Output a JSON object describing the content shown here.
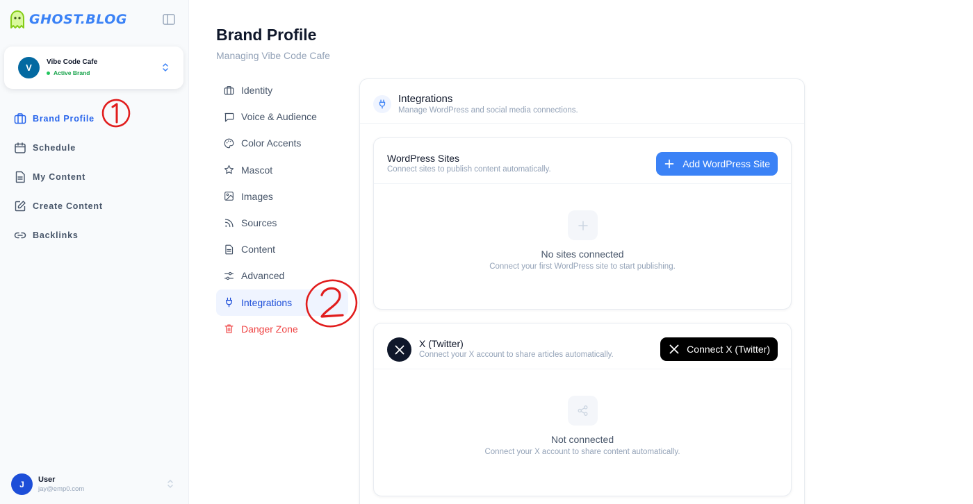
{
  "app": {
    "logo_text": "GHOST.BLOG"
  },
  "brand": {
    "avatar_initial": "V",
    "name": "Vibe Code Cafe",
    "status": "Active Brand"
  },
  "sidebar": {
    "items": [
      {
        "label": "Brand Profile",
        "icon": "briefcase-icon",
        "active": true
      },
      {
        "label": "Schedule",
        "icon": "calendar-icon"
      },
      {
        "label": "My Content",
        "icon": "file-icon"
      },
      {
        "label": "Create Content",
        "icon": "edit-icon"
      },
      {
        "label": "Backlinks",
        "icon": "link-icon"
      }
    ]
  },
  "user": {
    "avatar_initial": "J",
    "name": "User",
    "email": "jay@emp0.com"
  },
  "page": {
    "title": "Brand Profile",
    "subtitle": "Managing Vibe Code Cafe"
  },
  "subnav": {
    "items": [
      {
        "label": "Identity",
        "icon": "briefcase-icon"
      },
      {
        "label": "Voice & Audience",
        "icon": "message-icon"
      },
      {
        "label": "Color Accents",
        "icon": "palette-icon"
      },
      {
        "label": "Mascot",
        "icon": "star-icon"
      },
      {
        "label": "Images",
        "icon": "image-icon"
      },
      {
        "label": "Sources",
        "icon": "rss-icon"
      },
      {
        "label": "Content",
        "icon": "file-icon"
      },
      {
        "label": "Advanced",
        "icon": "sliders-icon"
      },
      {
        "label": "Integrations",
        "icon": "plug-icon",
        "active": true
      },
      {
        "label": "Danger Zone",
        "icon": "trash-icon",
        "danger": true
      }
    ]
  },
  "integrations": {
    "title": "Integrations",
    "description": "Manage WordPress and social media connections.",
    "wordpress": {
      "title": "WordPress Sites",
      "description": "Connect sites to publish content automatically.",
      "button": "Add WordPress Site",
      "empty_title": "No sites connected",
      "empty_desc": "Connect your first WordPress site to start publishing."
    },
    "twitter": {
      "title": "X (Twitter)",
      "description": "Connect your X account to share articles automatically.",
      "button": "Connect X (Twitter)",
      "empty_title": "Not connected",
      "empty_desc": "Connect your X account to share content automatically."
    }
  },
  "annotations": {
    "mark_1": "1",
    "mark_2": "2"
  },
  "colors": {
    "accent": "#3b82f6",
    "active_text": "#2563eb",
    "danger": "#ef4444",
    "success": "#22c55e",
    "annotation": "#e11d1d"
  }
}
